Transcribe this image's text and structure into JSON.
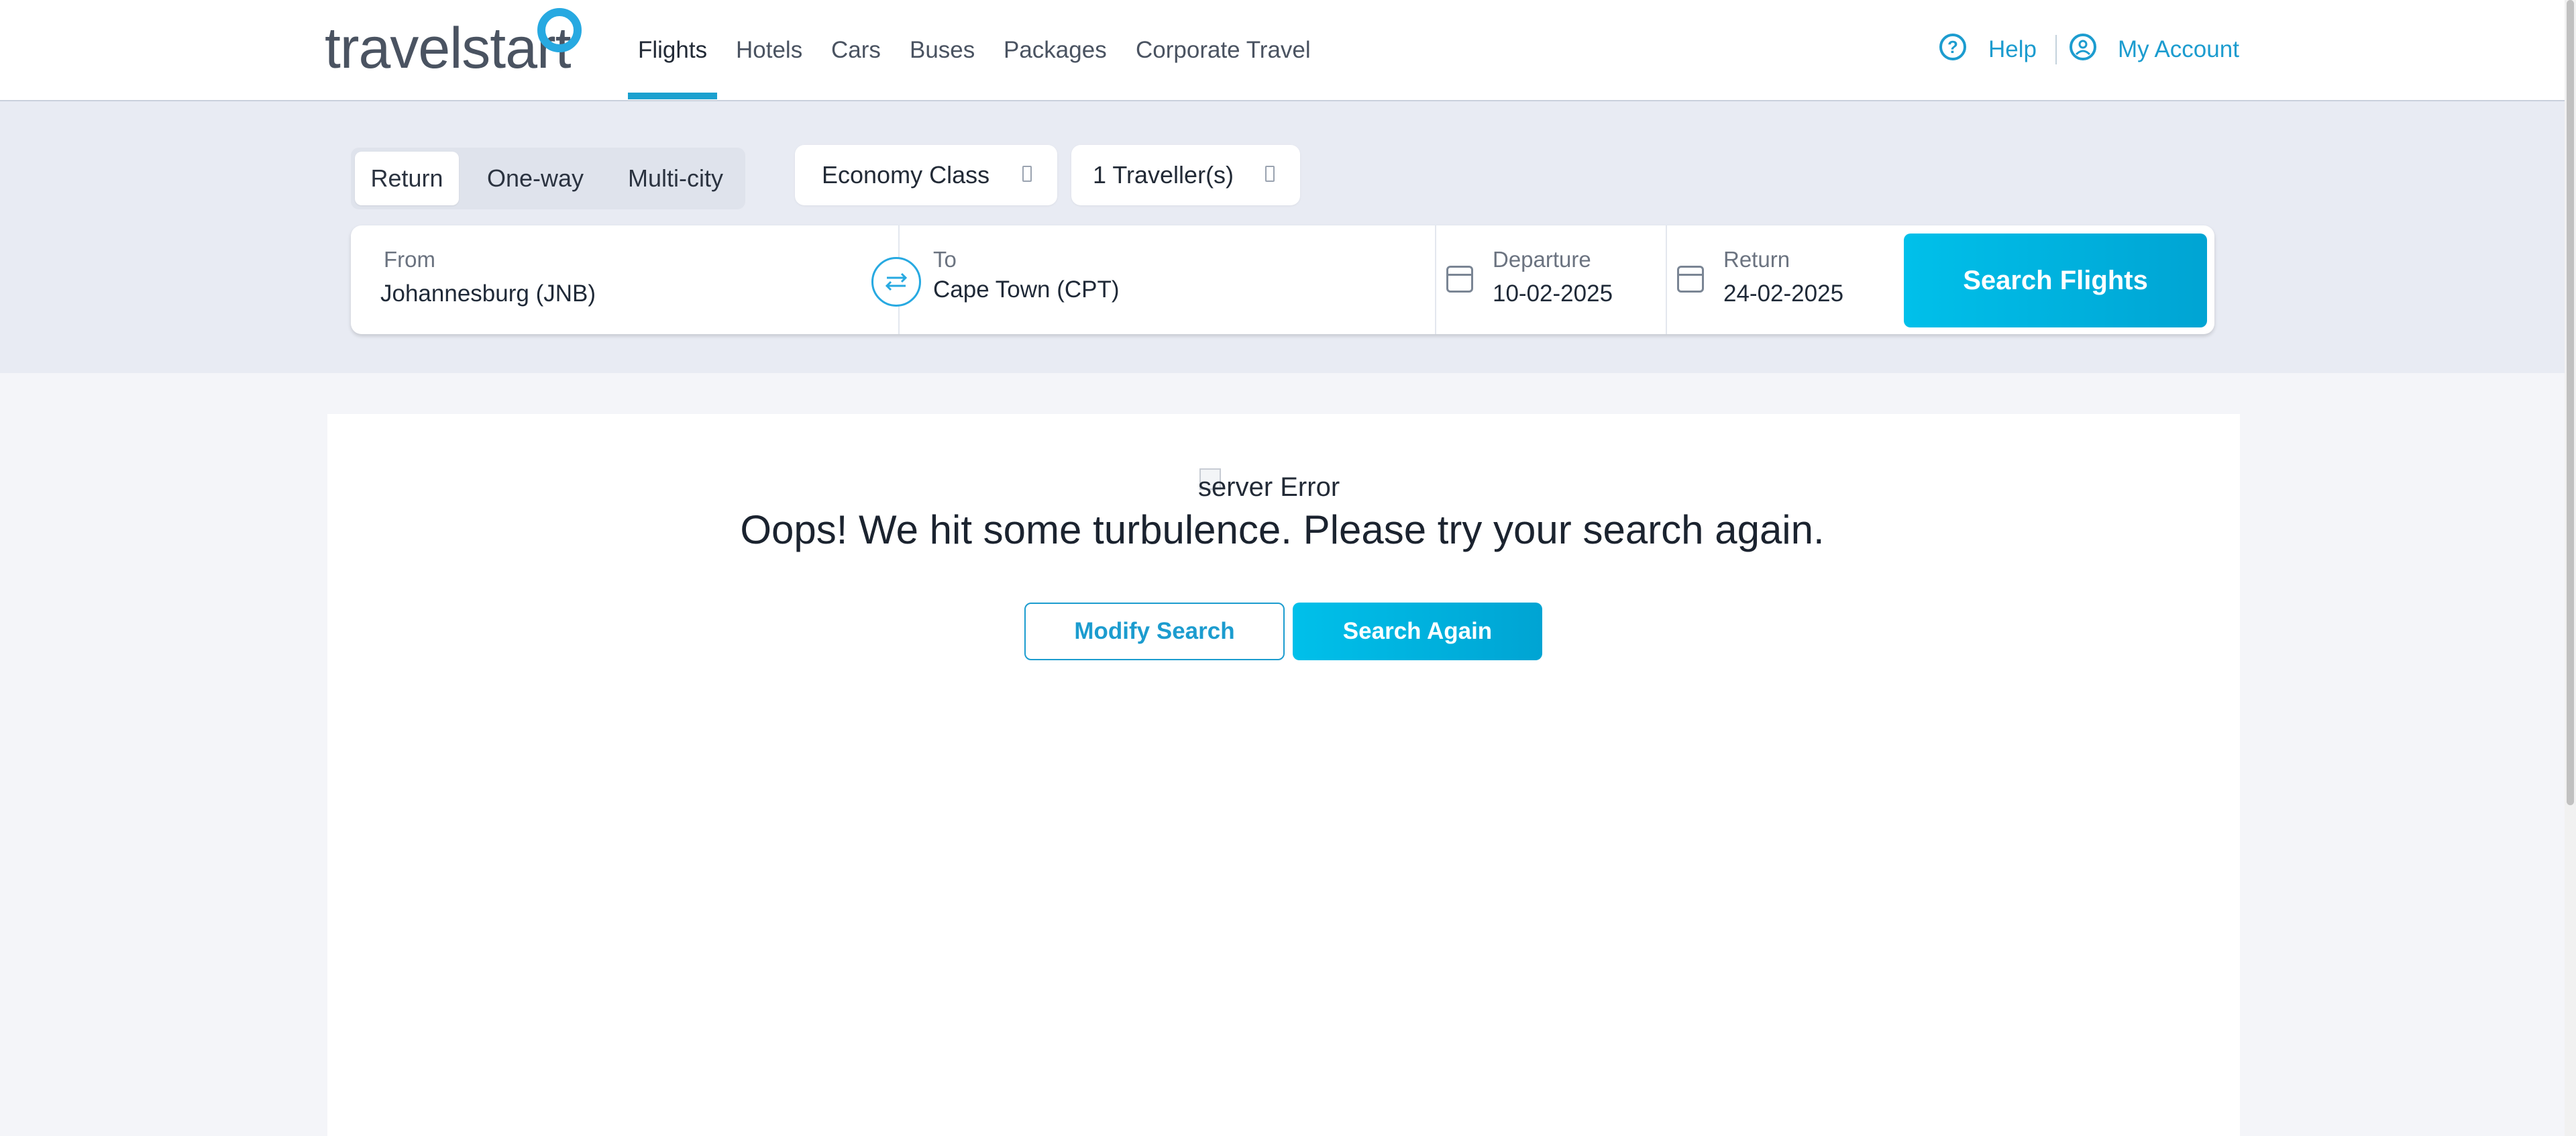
{
  "header": {
    "logo_text": "travelstart",
    "nav": [
      "Flights",
      "Hotels",
      "Cars",
      "Buses",
      "Packages",
      "Corporate Travel"
    ],
    "active_nav": "Flights",
    "help_label": "Help",
    "account_label": "My Account",
    "accent_color": "#1c9ccf"
  },
  "search": {
    "trip_types": [
      "Return",
      "One-way",
      "Multi-city"
    ],
    "selected_trip_type": "Return",
    "cabin_class": "Economy Class",
    "travellers": "1 Traveller(s)",
    "from_label": "From",
    "from_value": "Johannesburg (JNB)",
    "to_label": "To",
    "to_value": "Cape Town (CPT)",
    "departure_label": "Departure",
    "departure_value": "10-02-2025",
    "return_label": "Return",
    "return_value": "24-02-2025",
    "search_button": "Search Flights"
  },
  "error": {
    "image_alt": "server Error",
    "message": "Oops! We hit some turbulence. Please try your search again.",
    "modify_button": "Modify Search",
    "retry_button": "Search Again"
  },
  "icons": [
    "logo-ring-icon",
    "help-icon",
    "account-icon",
    "swap-icon",
    "calendar-icon",
    "chevron-down-icon"
  ]
}
